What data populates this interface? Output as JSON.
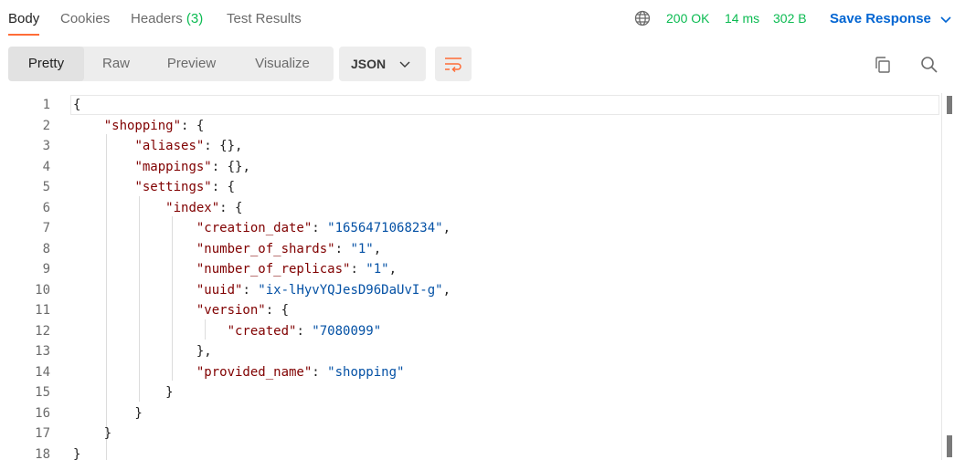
{
  "tabs": [
    {
      "label": "Body"
    },
    {
      "label": "Cookies"
    },
    {
      "label": "Headers",
      "count": "(3)"
    },
    {
      "label": "Test Results"
    }
  ],
  "status": {
    "code": "200 OK",
    "time": "14 ms",
    "size": "302 B"
  },
  "save_response": "Save Response",
  "view_modes": [
    "Pretty",
    "Raw",
    "Preview",
    "Visualize"
  ],
  "format": "JSON",
  "colors": {
    "accent": "#ff6c37",
    "success": "#0cbb52",
    "link": "#0265d2",
    "key": "#800000",
    "string": "#0451a5"
  },
  "code_lines": [
    {
      "n": "1",
      "html": "<span class='p'>{</span>"
    },
    {
      "n": "2",
      "html": "    <span class='k'>\"shopping\"</span>: {"
    },
    {
      "n": "3",
      "html": "        <span class='k'>\"aliases\"</span>: {},"
    },
    {
      "n": "4",
      "html": "        <span class='k'>\"mappings\"</span>: {},"
    },
    {
      "n": "5",
      "html": "        <span class='k'>\"settings\"</span>: {"
    },
    {
      "n": "6",
      "html": "            <span class='k'>\"index\"</span>: {"
    },
    {
      "n": "7",
      "html": "                <span class='k'>\"creation_date\"</span>: <span class='s'>\"1656471068234\"</span>,"
    },
    {
      "n": "8",
      "html": "                <span class='k'>\"number_of_shards\"</span>: <span class='s'>\"1\"</span>,"
    },
    {
      "n": "9",
      "html": "                <span class='k'>\"number_of_replicas\"</span>: <span class='s'>\"1\"</span>,"
    },
    {
      "n": "10",
      "html": "                <span class='k'>\"uuid\"</span>: <span class='s'>\"ix-lHyvYQJesD96DaUvI-g\"</span>,"
    },
    {
      "n": "11",
      "html": "                <span class='k'>\"version\"</span>: {"
    },
    {
      "n": "12",
      "html": "                    <span class='k'>\"created\"</span>: <span class='s'>\"7080099\"</span>"
    },
    {
      "n": "13",
      "html": "                },"
    },
    {
      "n": "14",
      "html": "                <span class='k'>\"provided_name\"</span>: <span class='s'>\"shopping\"</span>"
    },
    {
      "n": "15",
      "html": "            }"
    },
    {
      "n": "16",
      "html": "        }"
    },
    {
      "n": "17",
      "html": "    }"
    },
    {
      "n": "18",
      "html": "}"
    }
  ]
}
